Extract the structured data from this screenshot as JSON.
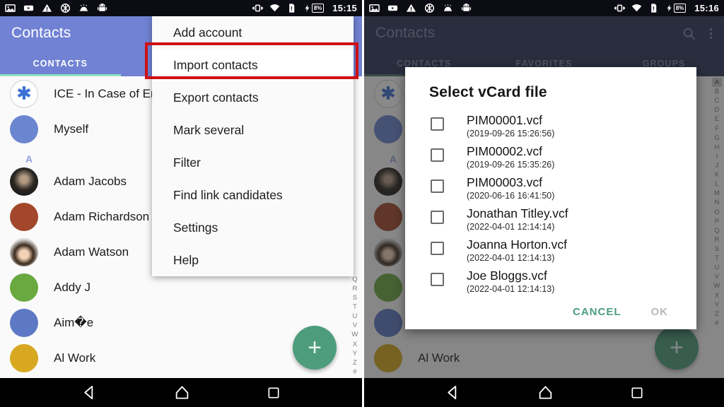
{
  "statusbar": {
    "icons_left": [
      "image-icon",
      "youtube-icon",
      "warning-icon",
      "no-data-icon",
      "alarm-icon",
      "android-icon"
    ],
    "icons_right": [
      "vibrate-icon",
      "wifi-icon",
      "sdcard-icon",
      "charging-icon"
    ],
    "battery_percent": "8%",
    "time_left": "15:15",
    "time_right": "15:16"
  },
  "app": {
    "title": "Contacts",
    "search_icon": "search-icon",
    "overflow_icon": "more-vertical-icon",
    "tabs": [
      {
        "label": "CONTACTS"
      },
      {
        "label": "FAVORITES"
      },
      {
        "label": "GROUPS"
      }
    ]
  },
  "contacts": [
    {
      "name": "ICE - In Case of Emergency",
      "avatar": "ice",
      "color": "#ffffff"
    },
    {
      "name": "Myself",
      "avatar": "solid",
      "color": "#6b86d0"
    },
    {
      "name": "Adam Jacobs",
      "avatar": "photo",
      "color": "#2e2a26"
    },
    {
      "name": "Adam Richardson",
      "avatar": "solid",
      "color": "#a3472c"
    },
    {
      "name": "Adam Watson",
      "avatar": "photo2",
      "color": "#d4d4d4"
    },
    {
      "name": "Addy J",
      "avatar": "solid",
      "color": "#6aa940"
    },
    {
      "name": "Aim�e",
      "avatar": "solid",
      "color": "#5d78c4"
    },
    {
      "name": "Al Work",
      "avatar": "solid",
      "color": "#d8a821"
    }
  ],
  "section_letter": "A",
  "alpha_index_left": [
    "Q",
    "R",
    "S",
    "T",
    "U",
    "V",
    "W",
    "X",
    "Y",
    "Z",
    "#"
  ],
  "alpha_index_right": [
    "A",
    "B",
    "C",
    "D",
    "E",
    "F",
    "G",
    "H",
    "I",
    "J",
    "K",
    "L",
    "M",
    "N",
    "O",
    "P",
    "Q",
    "R",
    "S",
    "T",
    "U",
    "V",
    "W",
    "X",
    "Y",
    "Z",
    "#"
  ],
  "alpha_selected_right": "A",
  "fab": {
    "icon": "plus-icon",
    "color": "#4d9d7c"
  },
  "overflow_menu": {
    "items": [
      {
        "label": "Add account",
        "highlighted": false
      },
      {
        "label": "Import contacts",
        "highlighted": true
      },
      {
        "label": "Export contacts",
        "highlighted": false
      },
      {
        "label": "Mark several",
        "highlighted": false
      },
      {
        "label": "Filter",
        "highlighted": false
      },
      {
        "label": "Find link candidates",
        "highlighted": false
      },
      {
        "label": "Settings",
        "highlighted": false
      },
      {
        "label": "Help",
        "highlighted": false
      }
    ],
    "highlight_color": "#cf1010"
  },
  "dialog": {
    "title": "Select vCard file",
    "files": [
      {
        "name": "PIM00001.vcf",
        "date": "(2019-09-26 15:26:56)",
        "checked": false
      },
      {
        "name": "PIM00002.vcf",
        "date": "(2019-09-26 15:35:26)",
        "checked": false
      },
      {
        "name": "PIM00003.vcf",
        "date": "(2020-06-16 16:41:50)",
        "checked": false
      },
      {
        "name": "Jonathan Titley.vcf",
        "date": "(2022-04-01 12:14:14)",
        "checked": false
      },
      {
        "name": "Joanna Horton.vcf",
        "date": "(2022-04-01 12:14:13)",
        "checked": false
      },
      {
        "name": "Joe Bloggs.vcf",
        "date": "(2022-04-01 12:14:13)",
        "checked": false
      }
    ],
    "cancel_label": "CANCEL",
    "ok_label": "OK",
    "cancel_color": "#4b9e84",
    "ok_color": "#b9b9b9"
  },
  "navbar": {
    "back_icon": "triangle-back-icon",
    "home_icon": "home-icon",
    "recents_icon": "square-recents-icon"
  }
}
